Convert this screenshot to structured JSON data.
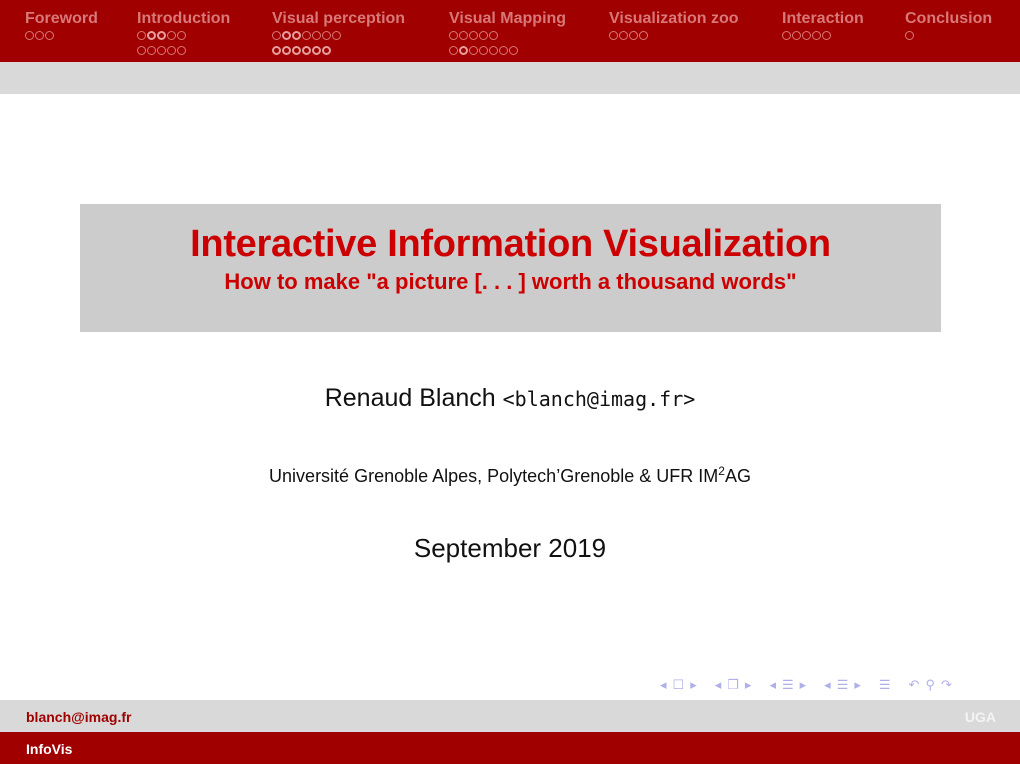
{
  "header": {
    "sections": [
      {
        "title": "Foreword",
        "rows": [
          [
            0,
            0,
            0
          ]
        ]
      },
      {
        "title": "Introduction",
        "rows": [
          [
            0,
            1,
            1,
            0,
            0
          ],
          [
            0,
            0,
            0,
            0,
            0
          ]
        ]
      },
      {
        "title": "Visual perception",
        "rows": [
          [
            0,
            1,
            1,
            0,
            0,
            0,
            0
          ],
          [
            1,
            1,
            1,
            1,
            1,
            1
          ]
        ]
      },
      {
        "title": "Visual Mapping",
        "rows": [
          [
            0,
            0,
            0,
            0,
            0
          ],
          [
            0,
            1,
            0,
            0,
            0,
            0,
            0
          ]
        ]
      },
      {
        "title": "Visualization zoo",
        "rows": [
          [
            0,
            0,
            0,
            0
          ]
        ]
      },
      {
        "title": "Interaction",
        "rows": [
          [
            0,
            0,
            0,
            0,
            0
          ]
        ]
      },
      {
        "title": "Conclusion",
        "rows": [
          [
            0
          ]
        ]
      }
    ]
  },
  "slide": {
    "title": "Interactive Information Visualization",
    "subtitle": "How to make \"a picture [. . . ] worth a thousand words\"",
    "author_name": "Renaud Blanch",
    "author_email": "<blanch@imag.fr>",
    "institute_prefix": "Université Grenoble Alpes, Polytech’Grenoble & UFR IM",
    "institute_sup": "2",
    "institute_suffix": "AG",
    "date": "September 2019"
  },
  "nav": {
    "frame_prev": "◂",
    "frame_icon": "☐",
    "frame_next": "▸",
    "subsec_prev": "◂",
    "subsec_icon": "❐",
    "subsec_next": "▸",
    "sec_prev": "◂",
    "sec_icon": "☰",
    "sec_next": "▸",
    "part_prev": "◂",
    "part_icon": "☰",
    "part_next": "▸",
    "doc_icon": "☰",
    "back_icon": "↶",
    "search_icon": "⚲",
    "forward_icon": "↷"
  },
  "footer": {
    "author": "blanch@imag.fr",
    "institute": "UGA",
    "short_title": "InfoVis"
  },
  "colors": {
    "brand_red": "#a00000",
    "title_red": "#cc0000",
    "box_grey": "#cccccc",
    "bar_grey": "#d9d9d9"
  }
}
